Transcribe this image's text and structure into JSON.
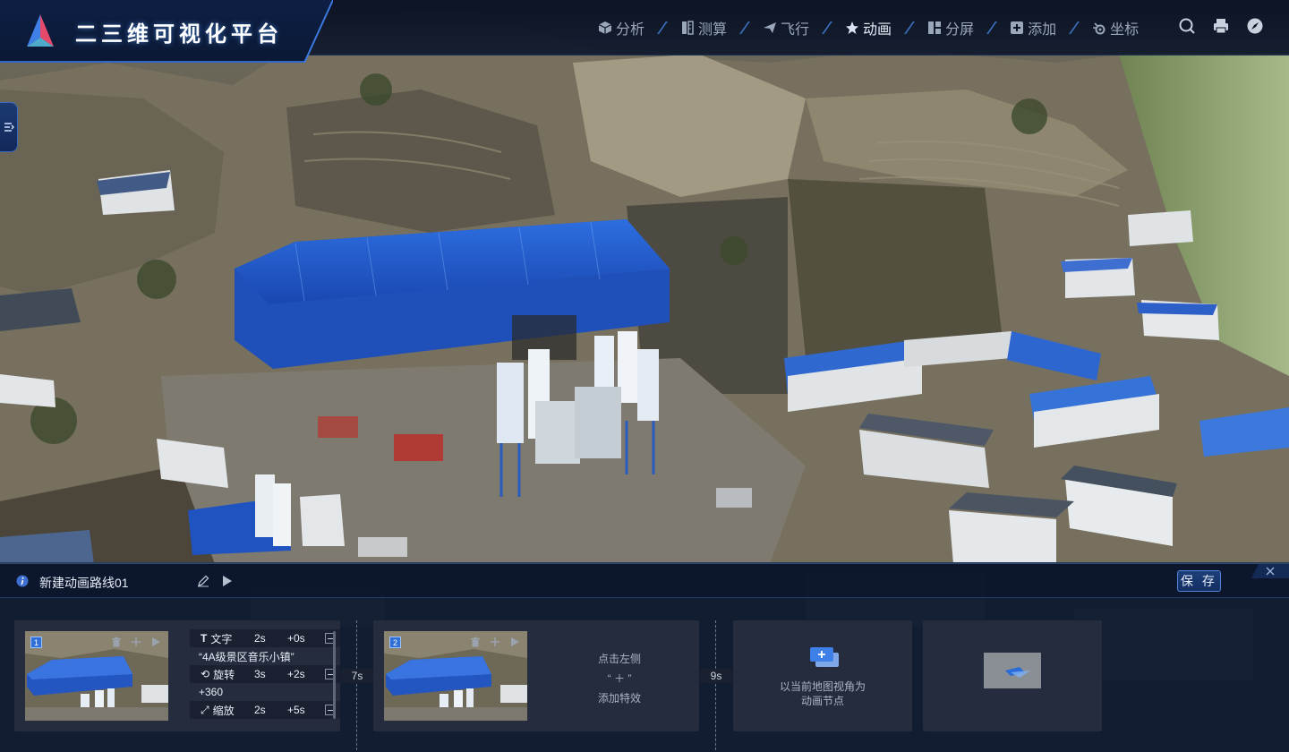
{
  "header": {
    "title": "二三维可视化平台",
    "nav": [
      {
        "label": "分析",
        "icon": "cube-icon",
        "active": false
      },
      {
        "label": "测算",
        "icon": "ruler-icon",
        "active": false
      },
      {
        "label": "飞行",
        "icon": "paper-plane-icon",
        "active": false
      },
      {
        "label": "动画",
        "icon": "star-icon",
        "active": true
      },
      {
        "label": "分屏",
        "icon": "split-screen-icon",
        "active": false
      },
      {
        "label": "添加",
        "icon": "plus-square-icon",
        "active": false
      },
      {
        "label": "坐标",
        "icon": "coordinate-icon",
        "active": false
      }
    ],
    "tools": [
      "search-icon",
      "print-icon",
      "compass-icon"
    ],
    "accent": "#2f68c8"
  },
  "panel": {
    "route_name": "新建动画路线01",
    "save_label": "保 存",
    "nodes": [
      {
        "index": "1",
        "effects": [
          {
            "icon": "T",
            "name": "文字",
            "duration": "2s",
            "offset": "+0s",
            "value": "“4A级景区音乐小镇”"
          },
          {
            "icon": "⟲",
            "name": "旋转",
            "duration": "3s",
            "offset": "+2s",
            "value": "+360"
          },
          {
            "icon": "⤢",
            "name": "缩放",
            "duration": "2s",
            "offset": "+5s",
            "value": ""
          }
        ]
      },
      {
        "index": "2",
        "hint_lines": [
          "点击左侧",
          "“ ＋ ”",
          "添加特效"
        ]
      }
    ],
    "gaps": [
      "7s",
      "9s"
    ],
    "add_node_text": [
      "以当前地图视角为",
      "动画节点"
    ]
  }
}
